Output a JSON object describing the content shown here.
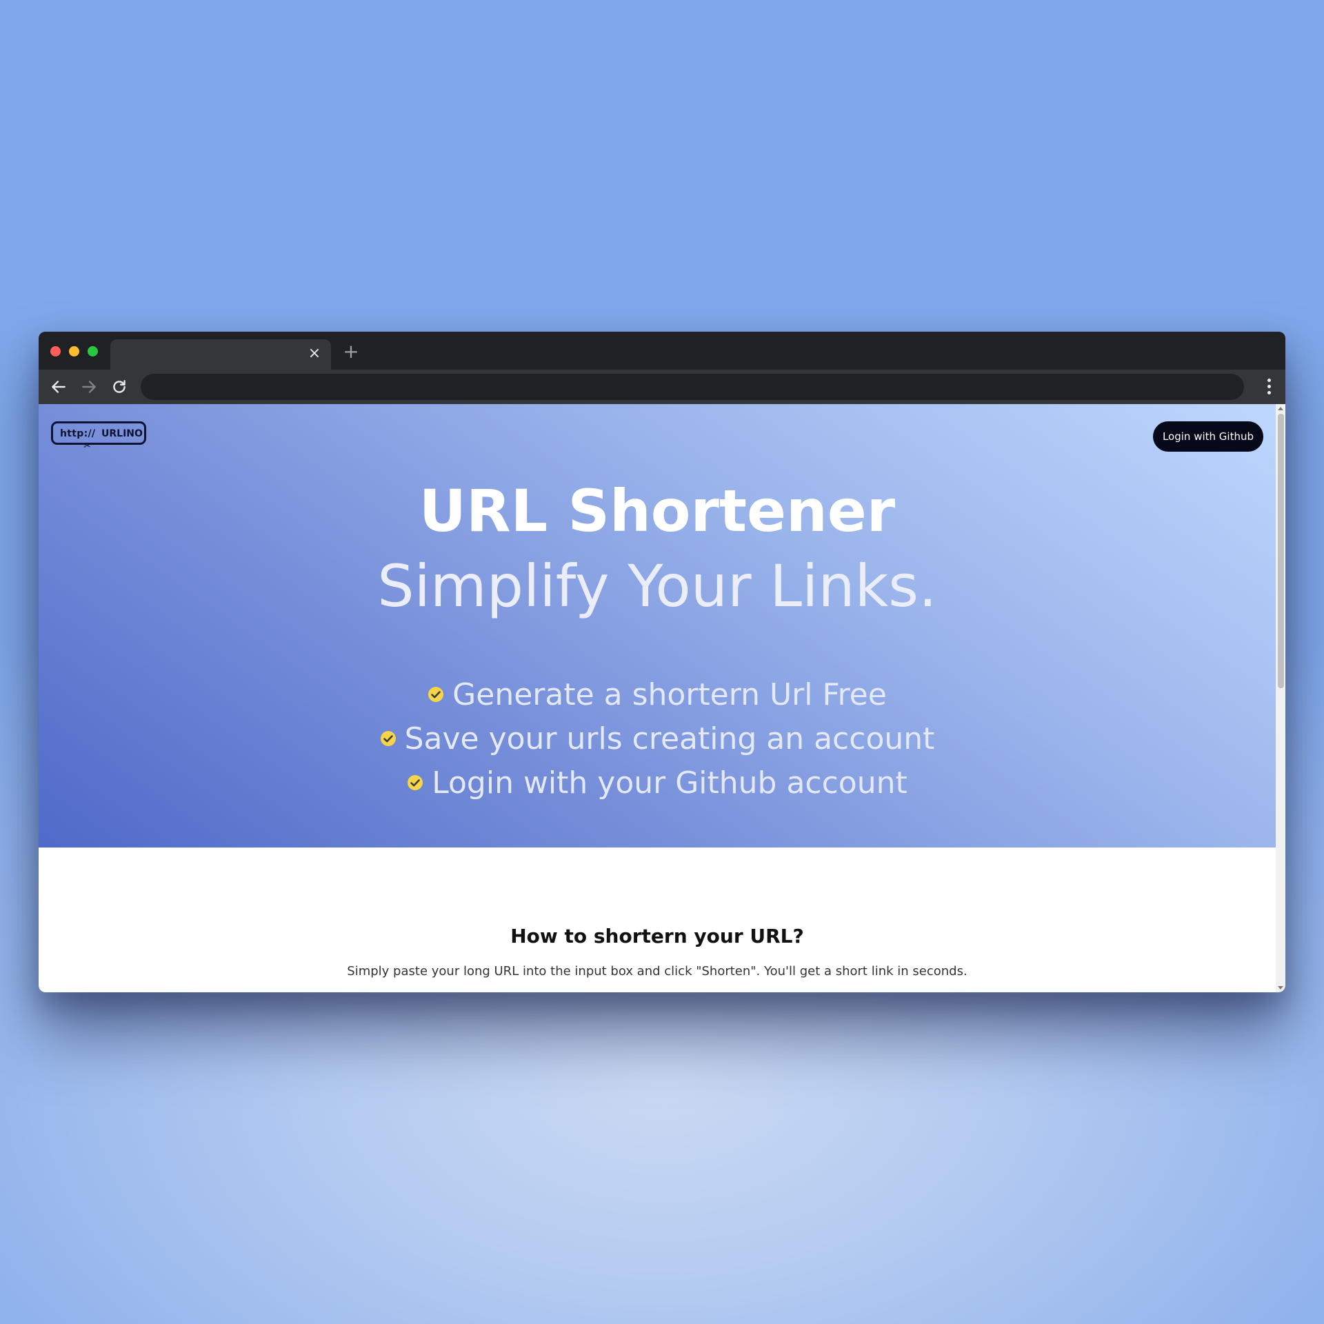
{
  "browser": {
    "tab_title": "",
    "tab_close": "×",
    "new_tab": "+",
    "address_value": ""
  },
  "header": {
    "logo_prefix": "http://",
    "logo_name": "URLINO",
    "login_label": "Login with Github"
  },
  "hero": {
    "title": "URL Shortener",
    "subtitle": "Simplify Your Links.",
    "features": [
      "Generate a shortern Url Free",
      "Save your urls creating an account",
      "Login with your Github account"
    ],
    "check_color": "#f7d547"
  },
  "how": {
    "title": "How to shortern your URL?",
    "text": "Simply paste your long URL into the input box and click \"Shorten\". You'll get a short link in seconds."
  }
}
